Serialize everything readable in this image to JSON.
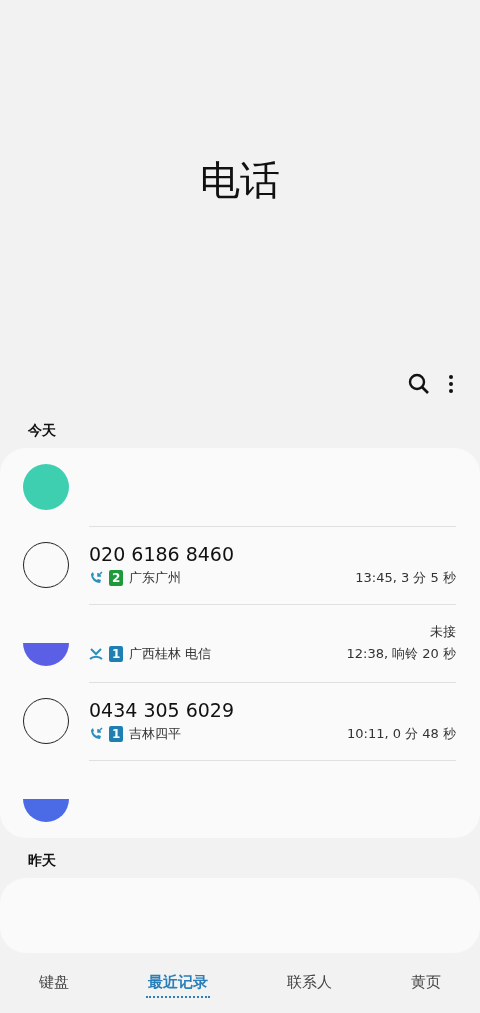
{
  "title": "电话",
  "sections": [
    {
      "label": "今天",
      "calls": [
        {
          "kind": "redacted",
          "avatar": {
            "color": "#3ecfb0",
            "cut": false
          }
        },
        {
          "kind": "call",
          "number": "020 6186 8460",
          "missed": false,
          "sim": {
            "label": "2",
            "color": "#1e9a3c"
          },
          "location": "广东广州",
          "detail": "13:45, 3 分 5 秒"
        },
        {
          "kind": "partial",
          "avatar": {
            "color": "#5a5fe6",
            "cut": true
          },
          "status": "未接",
          "missed": true,
          "sim": {
            "label": "1",
            "color": "#1f7fb3"
          },
          "location": "广西桂林 电信",
          "detail": "12:38, 响铃 20 秒"
        },
        {
          "kind": "call",
          "number": "0434 305 6029",
          "missed": false,
          "sim": {
            "label": "1",
            "color": "#1f7fb3"
          },
          "location": "吉林四平",
          "detail": "10:11, 0 分 48 秒"
        },
        {
          "kind": "redacted",
          "avatar": {
            "color": "#4a6ae6",
            "cut": true
          }
        }
      ]
    },
    {
      "label": "昨天",
      "calls": [
        {
          "kind": "redacted"
        }
      ]
    }
  ],
  "tabs": [
    {
      "label": "键盘",
      "selected": false
    },
    {
      "label": "最近记录",
      "selected": true
    },
    {
      "label": "联系人",
      "selected": false
    },
    {
      "label": "黄页",
      "selected": false
    }
  ]
}
